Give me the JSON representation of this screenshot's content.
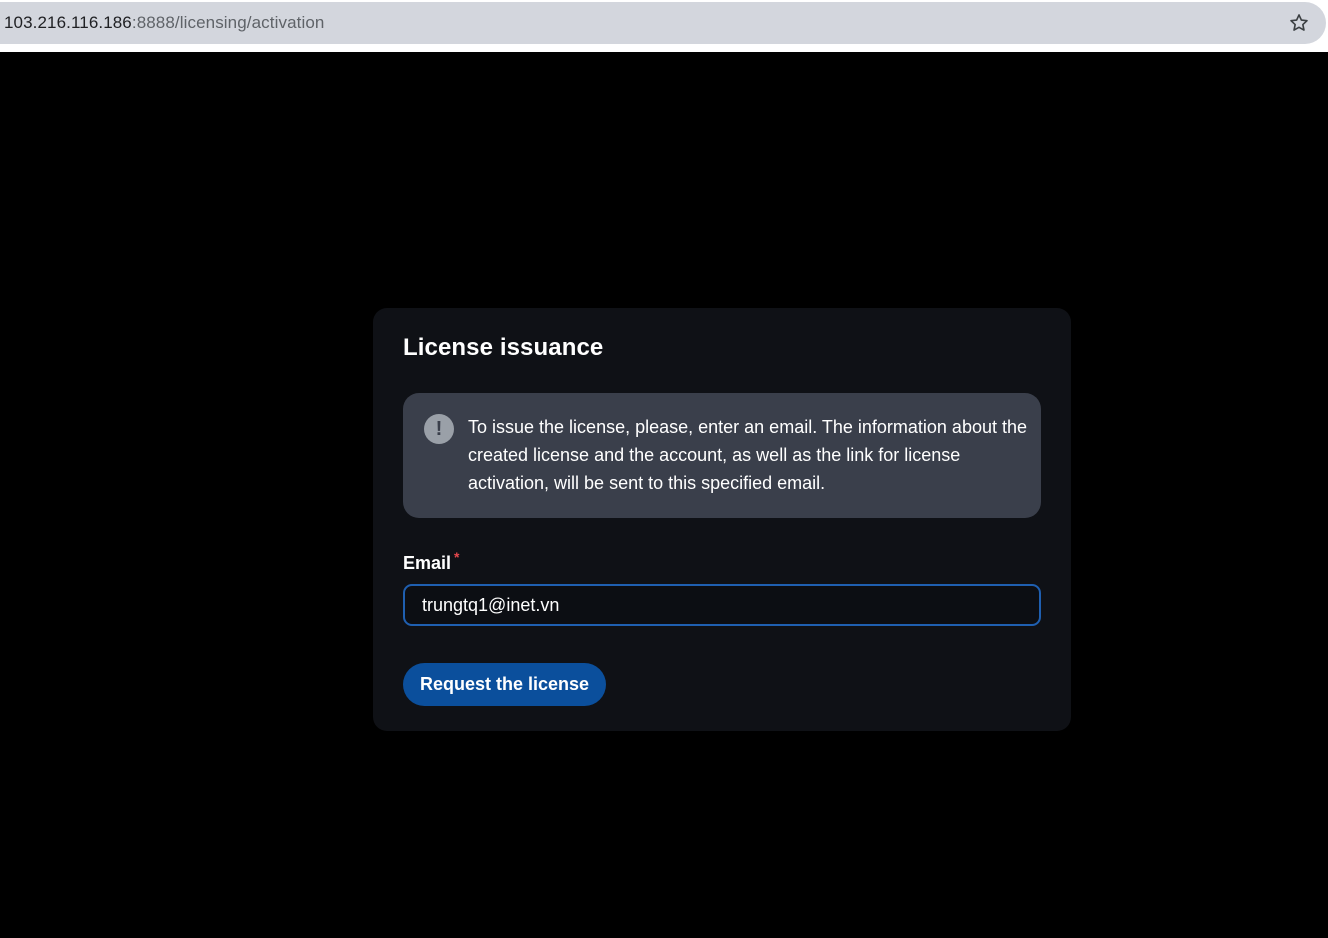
{
  "browser": {
    "url_host": "103.216.116.186",
    "url_path": ":8888/licensing/activation",
    "bookmark_icon": "star-icon"
  },
  "card": {
    "title": "License issuance",
    "info": {
      "icon": "exclamation-icon",
      "icon_glyph": "!",
      "text": "To issue the license, please, enter an email. The information about the created license and the account, as well as the link for license activation, will be sent to this specified email."
    },
    "email": {
      "label": "Email",
      "required_mark": "*",
      "value": "trungtq1@inet.vn"
    },
    "submit_label": "Request the license"
  },
  "colors": {
    "page_bg": "#000000",
    "card_bg": "#0f1116",
    "info_bg": "#3a3f4b",
    "accent": "#0b4f9c",
    "input_border": "#1f5fb0",
    "required": "#e5484d"
  }
}
